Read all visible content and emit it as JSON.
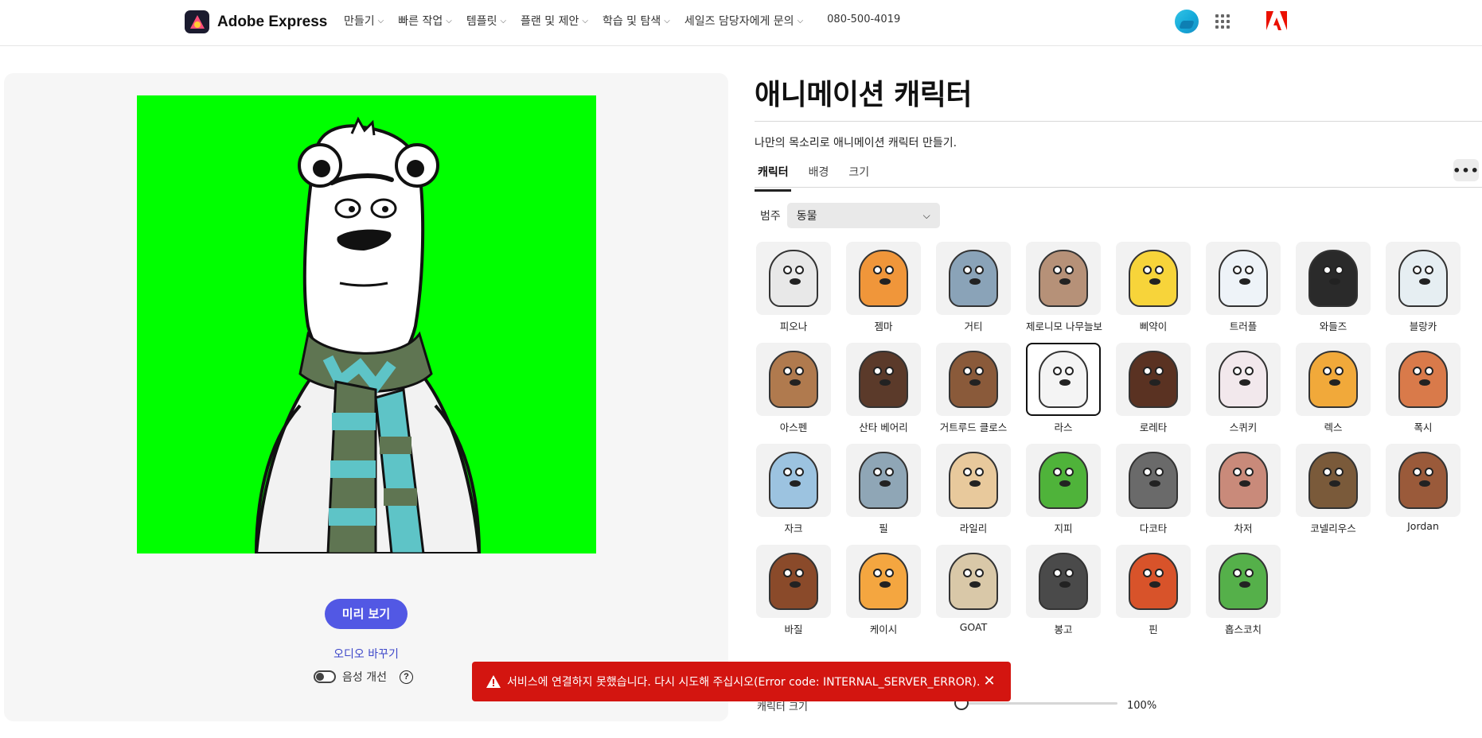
{
  "brand": {
    "name": "Adobe Express"
  },
  "nav": {
    "items": [
      "만들기",
      "빠른 작업",
      "템플릿",
      "플랜 및 제안",
      "학습 및 탐색",
      "세일즈 담당자에게 문의"
    ],
    "phone": "080-500-4019"
  },
  "preview": {
    "preview_button": "미리 보기",
    "audio_link": "오디오 바꾸기",
    "voice_label": "음성 개선",
    "help_glyph": "?"
  },
  "panel": {
    "title": "애니메이션 캐릭터",
    "subtitle": "나만의 목소리로 애니메이션 캐릭터 만들기.",
    "tabs": [
      "캐릭터",
      "배경",
      "크기"
    ],
    "more_glyph": "•••",
    "category_label": "범주",
    "category_value": "동물"
  },
  "characters": [
    {
      "name": "피오나",
      "color": "#e8e8e8"
    },
    {
      "name": "젬마",
      "color": "#f0963a"
    },
    {
      "name": "거티",
      "color": "#8aa3b8"
    },
    {
      "name": "제로니모 나무늘보",
      "color": "#b69178"
    },
    {
      "name": "삐약이",
      "color": "#f7d43a"
    },
    {
      "name": "트러플",
      "color": "#eef3f8"
    },
    {
      "name": "와들즈",
      "color": "#2a2a2a"
    },
    {
      "name": "블랑카",
      "color": "#e6eef2"
    },
    {
      "name": "아스펜",
      "color": "#b07a4e"
    },
    {
      "name": "산타 베어리",
      "color": "#5b3a2a"
    },
    {
      "name": "거트루드 클로스",
      "color": "#8a5a3a"
    },
    {
      "name": "라스",
      "color": "#f4f4f4"
    },
    {
      "name": "로레타",
      "color": "#5a3222"
    },
    {
      "name": "스퀴키",
      "color": "#f2e8ec"
    },
    {
      "name": "렉스",
      "color": "#f1a93a"
    },
    {
      "name": "폭시",
      "color": "#d97a4a"
    },
    {
      "name": "자크",
      "color": "#9cc3e0"
    },
    {
      "name": "필",
      "color": "#8fa6b6"
    },
    {
      "name": "라일리",
      "color": "#e8c99c"
    },
    {
      "name": "지피",
      "color": "#4fb33a"
    },
    {
      "name": "다코타",
      "color": "#6a6a6a"
    },
    {
      "name": "차저",
      "color": "#c98a7a"
    },
    {
      "name": "코넬리우스",
      "color": "#7a5a3a"
    },
    {
      "name": "Jordan",
      "color": "#9a5a3a"
    },
    {
      "name": "바질",
      "color": "#8a4a2a"
    },
    {
      "name": "케이시",
      "color": "#f4a640"
    },
    {
      "name": "GOAT",
      "color": "#d9c8a8"
    },
    {
      "name": "봉고",
      "color": "#4a4a4a"
    },
    {
      "name": "핀",
      "color": "#d8532a"
    },
    {
      "name": "홉스코치",
      "color": "#55b04a"
    }
  ],
  "selected_character": "라스",
  "size": {
    "label": "캐릭터 크기",
    "value": "100%"
  },
  "toast": {
    "message": "서비스에 연결하지 못했습니다. 다시 시도해 주십시오(Error code: INTERNAL_SERVER_ERROR).",
    "close_glyph": "✕"
  },
  "colors": {
    "accent": "#5258e4",
    "canvas_bg": "#00ff00",
    "error": "#d31510"
  },
  "icons": [
    "adobe-express-logo",
    "chevron-down-icon",
    "avatar",
    "apps-grid-icon",
    "adobe-logo",
    "help-icon",
    "more-icon",
    "warning-icon",
    "close-icon"
  ]
}
